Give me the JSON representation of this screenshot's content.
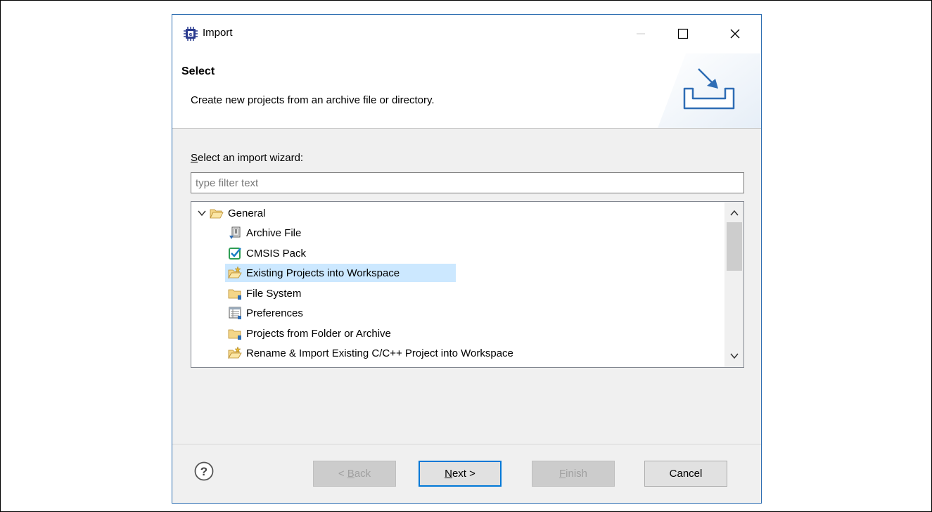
{
  "window": {
    "title": "Import",
    "app_icon": "eclipse-chip-icon",
    "controls": {
      "minimize": "minimize-icon",
      "maximize": "maximize-icon",
      "close": "close-icon"
    }
  },
  "header": {
    "title": "Select",
    "description": "Create new projects from an archive file or directory.",
    "graphic": "import-wizard-icon"
  },
  "wizard": {
    "label_accel": "S",
    "label_rest": "elect an import wizard:",
    "filter_placeholder": "type filter text",
    "filter_value": ""
  },
  "tree": {
    "group": {
      "label": "General",
      "expanded": true,
      "icon": "folder-open-icon"
    },
    "items": [
      {
        "label": "Archive File",
        "icon": "archive-file-icon",
        "selected": false
      },
      {
        "label": "CMSIS Pack",
        "icon": "cmsis-pack-icon",
        "selected": false
      },
      {
        "label": "Existing Projects into Workspace",
        "icon": "existing-projects-icon",
        "selected": true
      },
      {
        "label": "File System",
        "icon": "file-system-folder-icon",
        "selected": false
      },
      {
        "label": "Preferences",
        "icon": "preferences-icon",
        "selected": false
      },
      {
        "label": "Projects from Folder or Archive",
        "icon": "projects-folder-icon",
        "selected": false
      },
      {
        "label": "Rename & Import Existing C/C++ Project into Workspace",
        "icon": "rename-import-icon",
        "selected": false
      }
    ]
  },
  "buttons": {
    "help": "help-icon",
    "back": {
      "prefix": "< ",
      "accel": "B",
      "rest": "ack",
      "enabled": false
    },
    "next": {
      "accel": "N",
      "rest": "ext >",
      "enabled": true
    },
    "finish": {
      "accel": "F",
      "rest": "inish",
      "enabled": false
    },
    "cancel": {
      "label": "Cancel",
      "enabled": true
    }
  },
  "colors": {
    "accent": "#0078d7",
    "selection": "#cce8ff",
    "dialog_bg": "#f0f0f0",
    "border": "#2b6cb0"
  }
}
